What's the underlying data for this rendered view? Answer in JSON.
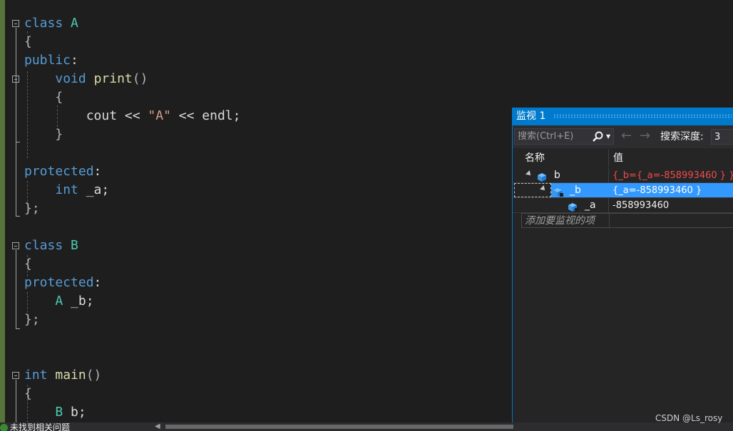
{
  "editor": {
    "lines": [
      [
        {
          "t": "class",
          "c": "kw"
        },
        {
          "t": " ",
          "c": "plain"
        },
        {
          "t": "A",
          "c": "type"
        }
      ],
      [
        {
          "t": "{",
          "c": "punct"
        }
      ],
      [
        {
          "t": "public",
          "c": "kw"
        },
        {
          "t": ":",
          "c": "plain"
        }
      ],
      [
        {
          "t": "    ",
          "c": "plain"
        },
        {
          "t": "void",
          "c": "kw"
        },
        {
          "t": " ",
          "c": "plain"
        },
        {
          "t": "print",
          "c": "fn"
        },
        {
          "t": "()",
          "c": "punct"
        }
      ],
      [
        {
          "t": "    ",
          "c": "plain"
        },
        {
          "t": "{",
          "c": "punct"
        }
      ],
      [
        {
          "t": "        ",
          "c": "plain"
        },
        {
          "t": "cout",
          "c": "var"
        },
        {
          "t": " << ",
          "c": "plain"
        },
        {
          "t": "\"A\"",
          "c": "str"
        },
        {
          "t": " << ",
          "c": "plain"
        },
        {
          "t": "endl",
          "c": "var"
        },
        {
          "t": ";",
          "c": "plain"
        }
      ],
      [
        {
          "t": "    ",
          "c": "plain"
        },
        {
          "t": "}",
          "c": "punct"
        }
      ],
      [],
      [
        {
          "t": "protected",
          "c": "kw"
        },
        {
          "t": ":",
          "c": "plain"
        }
      ],
      [
        {
          "t": "    ",
          "c": "plain"
        },
        {
          "t": "int",
          "c": "kw"
        },
        {
          "t": " _a;",
          "c": "plain"
        }
      ],
      [
        {
          "t": "};",
          "c": "punct"
        }
      ],
      [],
      [
        {
          "t": "class",
          "c": "kw"
        },
        {
          "t": " ",
          "c": "plain"
        },
        {
          "t": "B",
          "c": "type"
        }
      ],
      [
        {
          "t": "{",
          "c": "punct"
        }
      ],
      [
        {
          "t": "protected",
          "c": "kw"
        },
        {
          "t": ":",
          "c": "plain"
        }
      ],
      [
        {
          "t": "    ",
          "c": "plain"
        },
        {
          "t": "A",
          "c": "type"
        },
        {
          "t": " _b;",
          "c": "plain"
        }
      ],
      [
        {
          "t": "};",
          "c": "punct"
        }
      ],
      [],
      [],
      [
        {
          "t": "int",
          "c": "kw"
        },
        {
          "t": " ",
          "c": "plain"
        },
        {
          "t": "main",
          "c": "fn"
        },
        {
          "t": "()",
          "c": "punct"
        }
      ],
      [
        {
          "t": "{",
          "c": "punct"
        }
      ],
      [
        {
          "t": "    ",
          "c": "plain"
        },
        {
          "t": "B",
          "c": "type"
        },
        {
          "t": " b;",
          "c": "plain"
        }
      ]
    ]
  },
  "status": {
    "text": "未找到相关问题"
  },
  "watch": {
    "title": "监视 1",
    "search_placeholder": "搜索(Ctrl+E)",
    "depth_label": "搜索深度:",
    "depth_value": "3",
    "columns": {
      "name": "名称",
      "value": "值"
    },
    "rows": [
      {
        "name": "b",
        "value": "{_b={_a=-858993460 } }"
      },
      {
        "name": "_b",
        "value": "{_a=-858993460 }"
      },
      {
        "name": "_a",
        "value": "-858993460"
      }
    ],
    "add_item": "添加要监视的项"
  },
  "watermark": "CSDN @Ls_rosy",
  "colors": {
    "keyword": "#569cd6",
    "type": "#4ec9b0",
    "function": "#dcdcaa",
    "string": "#d69d85",
    "changed_value": "#f14c4c",
    "selection": "#3399ff",
    "accent": "#007acc"
  },
  "icons": {
    "fold": "collapse-box-icon",
    "search": "search-icon",
    "back": "back-arrow-icon",
    "forward": "forward-arrow-icon",
    "object": "object-cube-icon",
    "expander": "expander-triangle-icon"
  }
}
